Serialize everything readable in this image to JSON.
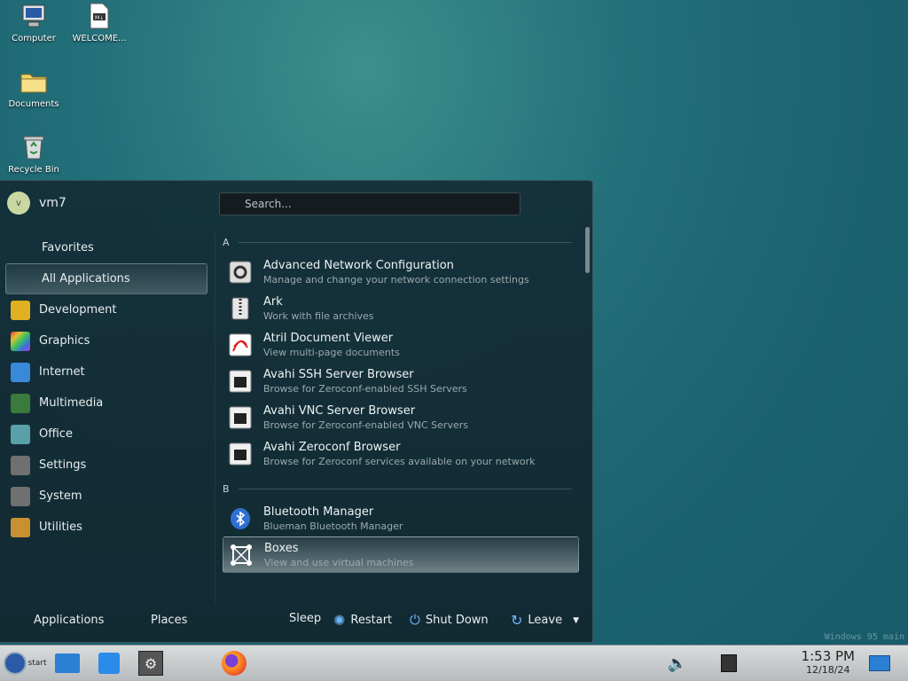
{
  "desktop": {
    "icons": [
      {
        "label": "Computer",
        "icon": "computer-icon"
      },
      {
        "label": "WELCOME...",
        "icon": "markdown-file-icon"
      },
      {
        "label": "Documents",
        "icon": "folder-icon"
      },
      {
        "label": "Recycle Bin",
        "icon": "recycle-bin-icon"
      }
    ],
    "watermark": "Windows 95 main"
  },
  "menu": {
    "user": {
      "initial": "v",
      "name": "vm7"
    },
    "search": {
      "placeholder": "Search..."
    },
    "categories": [
      {
        "label": "Favorites"
      },
      {
        "label": "All Applications"
      },
      {
        "label": "Development",
        "color": "#e0b020"
      },
      {
        "label": "Graphics",
        "color": "#d43aa0"
      },
      {
        "label": "Internet",
        "color": "#3a88d8"
      },
      {
        "label": "Multimedia",
        "color": "#3a7a3a"
      },
      {
        "label": "Office",
        "color": "#5aa0a8"
      },
      {
        "label": "Settings",
        "color": "#707070"
      },
      {
        "label": "System",
        "color": "#707070"
      },
      {
        "label": "Utilities",
        "color": "#c89030"
      }
    ],
    "sections": [
      {
        "letter": "A",
        "apps": [
          {
            "name": "Advanced Network Configuration",
            "desc": "Manage and change your network connection settings"
          },
          {
            "name": "Ark",
            "desc": "Work with file archives"
          },
          {
            "name": "Atril Document Viewer",
            "desc": "View multi-page documents"
          },
          {
            "name": "Avahi SSH Server Browser",
            "desc": "Browse for Zeroconf-enabled SSH Servers"
          },
          {
            "name": "Avahi VNC Server Browser",
            "desc": "Browse for Zeroconf-enabled VNC Servers"
          },
          {
            "name": "Avahi Zeroconf Browser",
            "desc": "Browse for Zeroconf services available on your network"
          }
        ]
      },
      {
        "letter": "B",
        "apps": [
          {
            "name": "Bluetooth Manager",
            "desc": "Blueman Bluetooth Manager"
          },
          {
            "name": "Boxes",
            "desc": "View and use virtual machines"
          }
        ]
      }
    ],
    "bottom": {
      "tabs": [
        "Applications",
        "Places"
      ],
      "sleep": "Sleep",
      "restart": "Restart",
      "shutdown": "Shut Down",
      "leave": "Leave"
    }
  },
  "taskbar": {
    "start_label": "start",
    "time": "1:53 PM",
    "date": "12/18/24"
  }
}
